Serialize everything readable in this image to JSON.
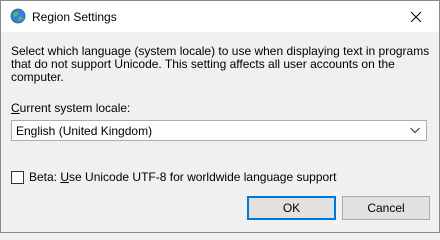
{
  "window": {
    "title": "Region Settings"
  },
  "content": {
    "description": "Select which language (system locale) to use when displaying text in programs that do not support Unicode. This setting affects all user accounts on the computer.",
    "locale_label_prefix": "C",
    "locale_label_rest": "urrent system locale:",
    "locale_value": "English (United Kingdom)",
    "beta_prefix": "Beta: ",
    "beta_accel": "U",
    "beta_rest": "se Unicode UTF-8 for worldwide language support",
    "beta_checked": false
  },
  "buttons": {
    "ok_label": "OK",
    "cancel_label": "Cancel"
  },
  "icons": {
    "app": "globe-icon",
    "close": "close-icon",
    "dropdown": "chevron-down-icon"
  },
  "colors": {
    "default_button_border": "#0078d7"
  }
}
